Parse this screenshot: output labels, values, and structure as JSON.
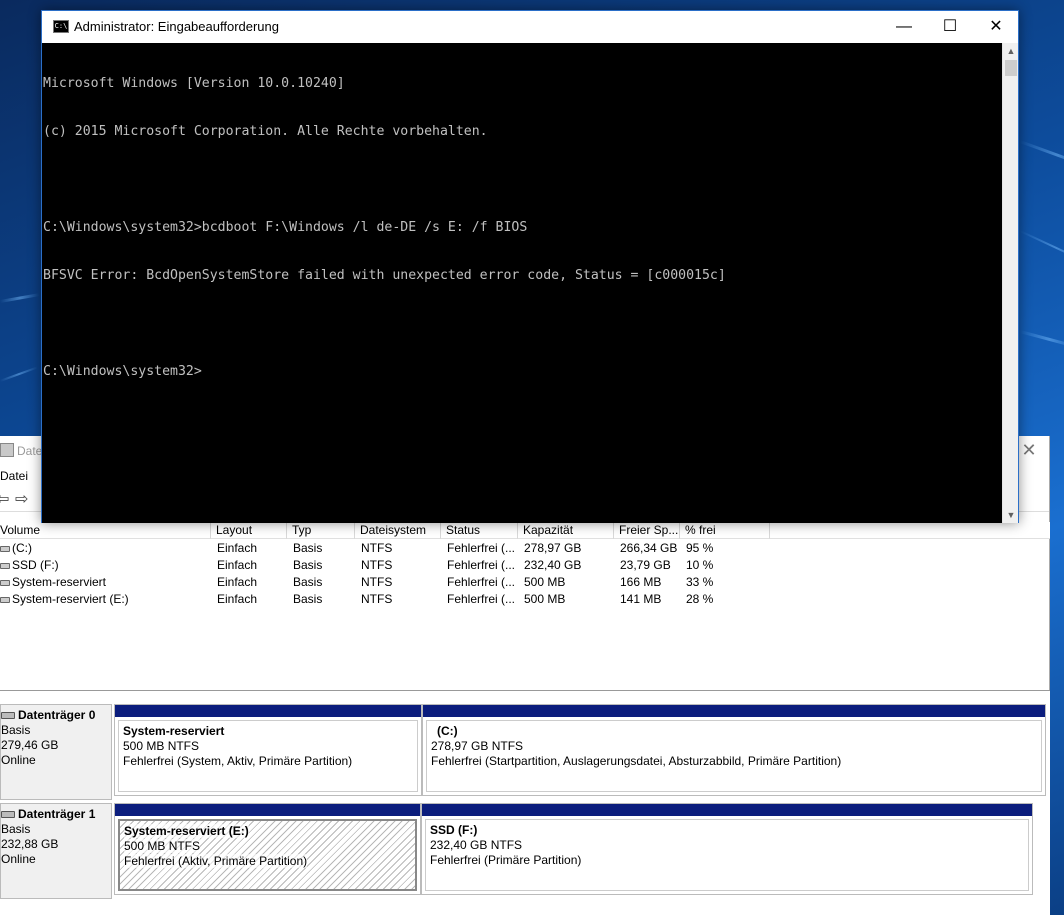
{
  "cmd_window": {
    "title": "Administrator: Eingabeaufforderung",
    "icon_label": "C:\\",
    "minimize": "—",
    "maximize": "☐",
    "close": "✕",
    "lines": [
      "Microsoft Windows [Version 10.0.10240]",
      "(c) 2015 Microsoft Corporation. Alle Rechte vorbehalten.",
      "",
      "C:\\Windows\\system32>bcdboot F:\\Windows /l de-DE /s E: /f BIOS",
      "BFSVC Error: BcdOpenSystemStore failed with unexpected error code, Status = [c000015c]",
      "",
      "C:\\Windows\\system32>"
    ],
    "scroll_up": "▲",
    "scroll_down": "▼"
  },
  "disk_mgmt": {
    "title": "Date",
    "close": "✕",
    "menu": {
      "file": "Datei"
    },
    "toolbar": {
      "back": "⇦",
      "forward": "⇨"
    },
    "columns": [
      "Volume",
      "Layout",
      "Typ",
      "Dateisystem",
      "Status",
      "Kapazität",
      "Freier Sp...",
      "% frei"
    ],
    "volumes": [
      {
        "name": "(C:)",
        "layout": "Einfach",
        "type": "Basis",
        "fs": "NTFS",
        "status": "Fehlerfrei (...",
        "capacity": "278,97 GB",
        "free": "266,34 GB",
        "pct": "95 %"
      },
      {
        "name": "SSD (F:)",
        "layout": "Einfach",
        "type": "Basis",
        "fs": "NTFS",
        "status": "Fehlerfrei (...",
        "capacity": "232,40 GB",
        "free": "23,79 GB",
        "pct": "10 %"
      },
      {
        "name": "System-reserviert",
        "layout": "Einfach",
        "type": "Basis",
        "fs": "NTFS",
        "status": "Fehlerfrei (...",
        "capacity": "500 MB",
        "free": "166 MB",
        "pct": "33 %"
      },
      {
        "name": "System-reserviert (E:)",
        "layout": "Einfach",
        "type": "Basis",
        "fs": "NTFS",
        "status": "Fehlerfrei (...",
        "capacity": "500 MB",
        "free": "141 MB",
        "pct": "28 %"
      }
    ],
    "disks": [
      {
        "name": "Datenträger 0",
        "type": "Basis",
        "size": "279,46 GB",
        "state": "Online",
        "partitions": [
          {
            "title": "System-reserviert",
            "size": "500 MB NTFS",
            "status": "Fehlerfrei (System, Aktiv, Primäre Partition)"
          },
          {
            "title": "(C:)",
            "size": "278,97 GB NTFS",
            "status": "Fehlerfrei (Startpartition, Auslagerungsdatei, Absturzabbild, Primäre Partition)"
          }
        ]
      },
      {
        "name": "Datenträger 1",
        "type": "Basis",
        "size": "232,88 GB",
        "state": "Online",
        "partitions": [
          {
            "title": "System-reserviert  (E:)",
            "size": "500 MB NTFS",
            "status": "Fehlerfrei (Aktiv, Primäre Partition)"
          },
          {
            "title": "SSD  (F:)",
            "size": "232,40 GB NTFS",
            "status": "Fehlerfrei (Primäre Partition)"
          }
        ]
      }
    ]
  }
}
